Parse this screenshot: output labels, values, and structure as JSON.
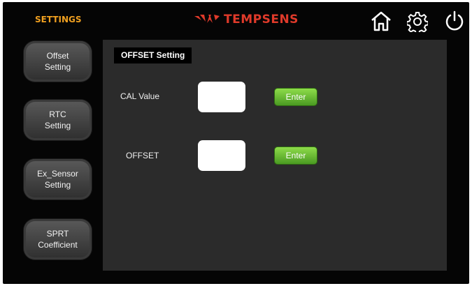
{
  "header": {
    "section_title": "SETTINGS",
    "brand_name": "TEMPSENS",
    "colors": {
      "accent": "#f0a020",
      "brand": "#e03a2a",
      "enter_button": "#5cb82c"
    }
  },
  "top_icons": [
    "home-icon",
    "gear-icon",
    "power-icon"
  ],
  "sidebar": {
    "items": [
      {
        "line1": "Offset",
        "line2": "Setting"
      },
      {
        "line1": "RTC",
        "line2": "Setting"
      },
      {
        "line1": "Ex_Sensor",
        "line2": "Setting"
      },
      {
        "line1": "SPRT",
        "line2": "Coefficient"
      }
    ]
  },
  "panel": {
    "tab_label": "OFFSET Setting",
    "fields": [
      {
        "label": "CAL Value",
        "value": "",
        "button_label": "Enter"
      },
      {
        "label": "OFFSET",
        "value": "",
        "button_label": "Enter"
      }
    ]
  }
}
